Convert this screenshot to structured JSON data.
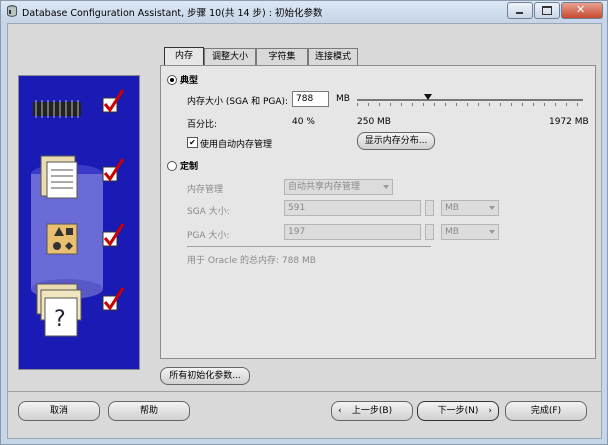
{
  "window": {
    "title": "Database Configuration Assistant, 步骤 10(共 14 步) : 初始化参数",
    "controls": [
      "minimize-icon",
      "maximize-icon",
      "close-icon"
    ]
  },
  "tabs": [
    "内存",
    "调整大小",
    "字符集",
    "连接模式"
  ],
  "active_tab": "内存",
  "typical": {
    "radio_label": "典型",
    "memory_size_label": "内存大小 (SGA 和 PGA):",
    "memory_size_value": "788",
    "memory_unit": "MB",
    "percent_label": "百分比:",
    "percent_value": "40 %",
    "slider": {
      "min_label": "250 MB",
      "max_label": "1972 MB",
      "value": 788,
      "min": 250,
      "max": 1972
    },
    "auto_memory_checkbox_label": "使用自动内存管理",
    "auto_memory_checked": true,
    "show_distribution_button": "显示内存分布..."
  },
  "custom": {
    "radio_label": "定制",
    "memory_management_label": "内存管理",
    "memory_management_value": "自动共享内存管理",
    "sga_label": "SGA 大小:",
    "sga_value": "591",
    "sga_unit": "MB",
    "pga_label": "PGA 大小:",
    "pga_value": "197",
    "pga_unit": "MB",
    "total_memory_text": "用于 Oracle 的总内存:  788 MB"
  },
  "all_params_button": "所有初始化参数...",
  "footer": {
    "cancel": "取消",
    "help": "帮助",
    "back": "上一步(B)",
    "next": "下一步(N)",
    "finish": "完成(F)"
  }
}
